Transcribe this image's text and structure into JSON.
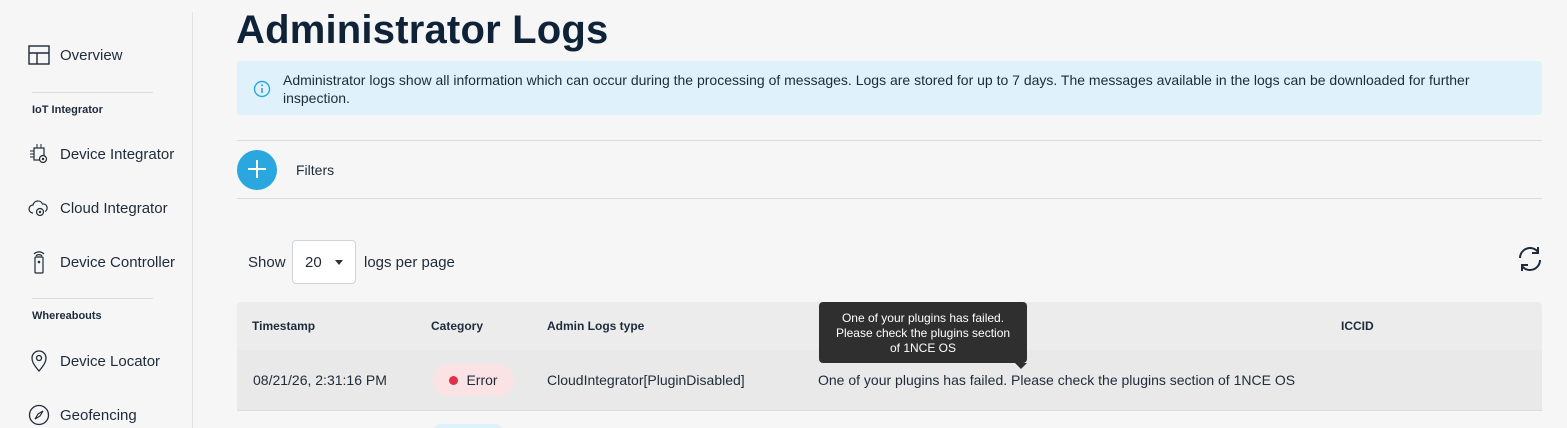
{
  "page": {
    "title": "Administrator Logs"
  },
  "sidebar": {
    "overview": "Overview",
    "section_iot": "IoT Integrator",
    "device_integrator": "Device Integrator",
    "cloud_integrator": "Cloud Integrator",
    "device_controller": "Device Controller",
    "section_whereabouts": "Whereabouts",
    "device_locator": "Device Locator",
    "geofencing": "Geofencing"
  },
  "banner": {
    "text": "Administrator logs show all information which can occur during the processing of messages. Logs are stored for up to 7 days. The messages available in the logs can be downloaded for further inspection."
  },
  "filters": {
    "label": "Filters"
  },
  "pagination": {
    "show_label": "Show",
    "per_page_value": "20",
    "per_page_suffix": "logs per page"
  },
  "table": {
    "headers": {
      "timestamp": "Timestamp",
      "category": "Category",
      "type": "Admin Logs type",
      "iccid": "ICCID"
    },
    "rows": [
      {
        "timestamp": "08/21/26, 2:31:16 PM",
        "category": "Error",
        "type": "CloudIntegrator[PluginDisabled]",
        "message": "One of your plugins has failed. Please check the plugins section of 1NCE OS",
        "iccid": ""
      }
    ]
  },
  "tooltip": {
    "line1": "One of your plugins has failed.",
    "line2": "Please check the plugins section",
    "line3": "of 1NCE OS"
  },
  "colors": {
    "accent": "#2aa7df",
    "banner_bg": "#dff1fb",
    "error_dot": "#e0304a",
    "error_bg": "#fbe3e5"
  }
}
